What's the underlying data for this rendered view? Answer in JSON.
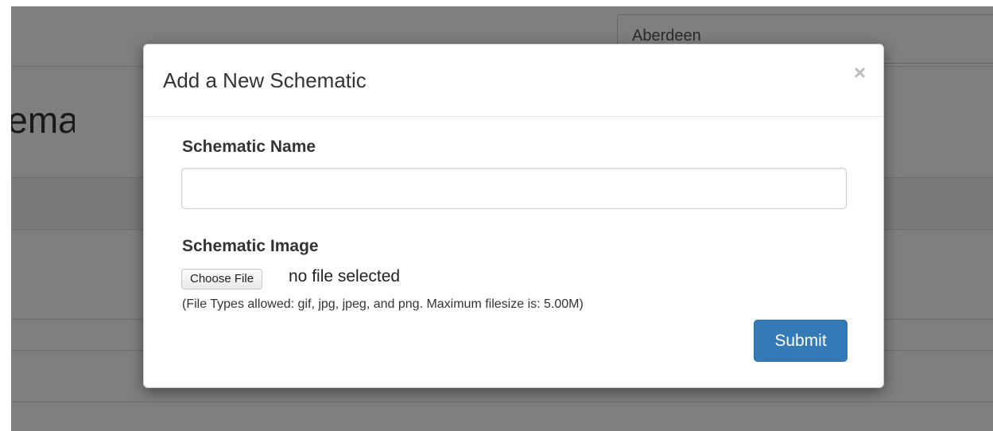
{
  "background": {
    "page_title": "Schematics",
    "location_select_value": "Aberdeen"
  },
  "modal": {
    "title": "Add a New Schematic",
    "close_label": "×",
    "name_field": {
      "label": "Schematic Name",
      "value": "",
      "placeholder": ""
    },
    "image_field": {
      "label": "Schematic Image",
      "choose_button_label": "Choose File",
      "file_status": "no file selected",
      "help_text": "(File Types allowed: gif, jpg, jpeg, and png. Maximum filesize is: 5.00M)"
    },
    "submit_label": "Submit"
  },
  "colors": {
    "primary": "#337ab7",
    "backdrop": "rgba(0,0,0,0.5)"
  }
}
